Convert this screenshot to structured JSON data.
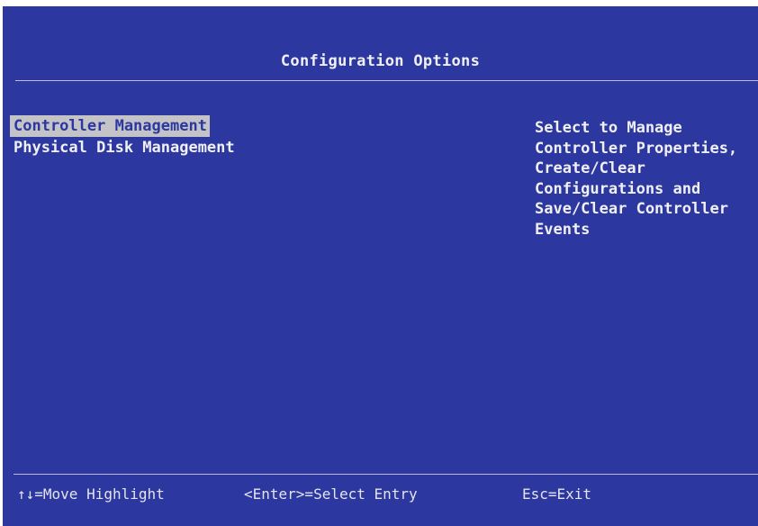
{
  "screen": {
    "title": "Configuration Options",
    "colors": {
      "background": "#2c38a0",
      "text": "#f0f0f2",
      "highlight": "#c4c4c8"
    }
  },
  "menu": {
    "items": [
      {
        "label": "Controller Management",
        "selected": true
      },
      {
        "label": "Physical Disk Management",
        "selected": false
      }
    ]
  },
  "help": {
    "lines": [
      "Select to Manage",
      "Controller Properties,",
      "Create/Clear",
      "Configurations and",
      "Save/Clear Controller",
      "Events"
    ]
  },
  "footer": {
    "move": "↑↓=Move Highlight",
    "select": "<Enter>=Select Entry",
    "exit": "Esc=Exit"
  }
}
